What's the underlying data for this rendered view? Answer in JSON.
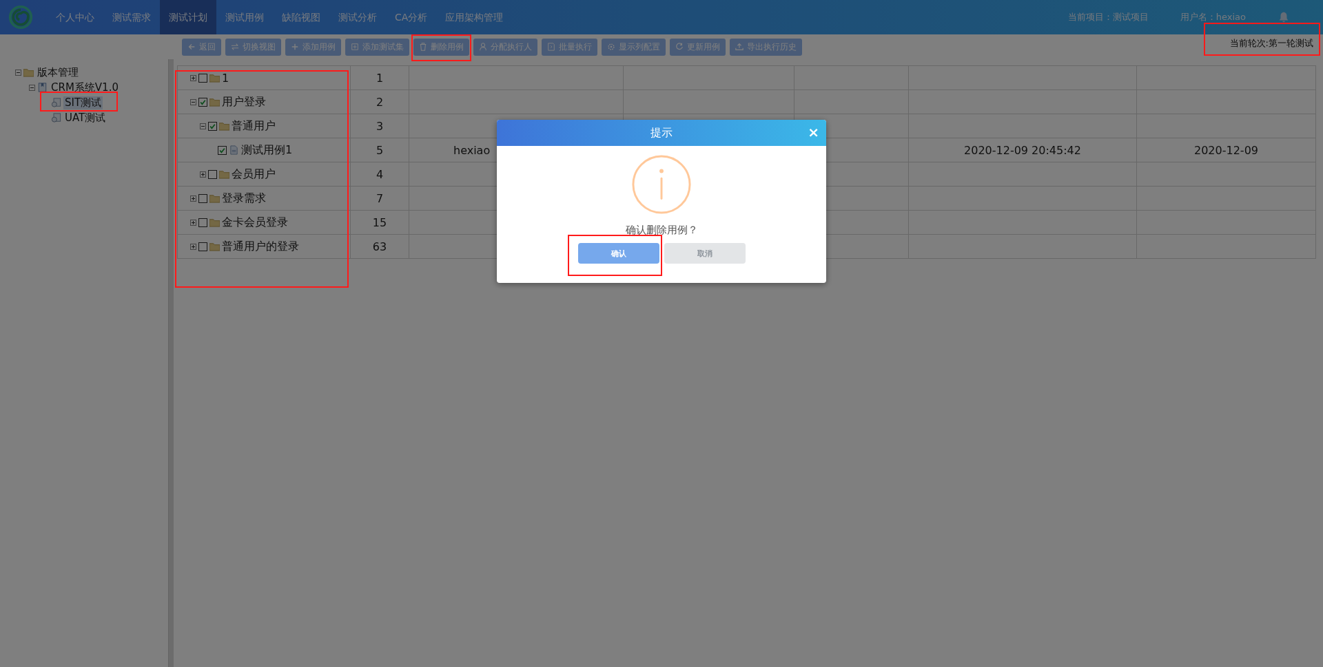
{
  "nav": {
    "items": [
      {
        "label": "个人中心",
        "selected": false
      },
      {
        "label": "测试需求",
        "selected": false
      },
      {
        "label": "测试计划",
        "selected": true
      },
      {
        "label": "测试用例",
        "selected": false
      },
      {
        "label": "缺陷视图",
        "selected": false
      },
      {
        "label": "测试分析",
        "selected": false
      },
      {
        "label": "CA分析",
        "selected": false
      },
      {
        "label": "应用架构管理",
        "selected": false
      }
    ],
    "project": "当前项目：测试项目",
    "user": "用户名：hexiao"
  },
  "toolbar": {
    "buttons": [
      {
        "label": "返回",
        "highlighted": false
      },
      {
        "label": "切换视图",
        "highlighted": false
      },
      {
        "label": "添加用例",
        "highlighted": false
      },
      {
        "label": "添加测试集",
        "highlighted": false
      },
      {
        "label": "删除用例",
        "highlighted": true
      },
      {
        "label": "分配执行人",
        "highlighted": false
      },
      {
        "label": "批量执行",
        "highlighted": false
      },
      {
        "label": "显示列配置",
        "highlighted": false
      },
      {
        "label": "更新用例",
        "highlighted": false
      },
      {
        "label": "导出执行历史",
        "highlighted": false
      }
    ],
    "round": {
      "label": "当前轮次:第一轮测试",
      "highlighted": true
    }
  },
  "sidebar": {
    "items": [
      {
        "label": "版本管理",
        "kind": "folder",
        "expanded": true,
        "selected": false,
        "highlighted": false,
        "children": [
          {
            "label": "CRM系统V1.0",
            "kind": "version",
            "expanded": true,
            "selected": false,
            "highlighted": false,
            "children": [
              {
                "label": "SIT测试",
                "kind": "plan",
                "selected": true,
                "highlighted": true
              },
              {
                "label": "UAT测试",
                "kind": "plan",
                "selected": false,
                "highlighted": false
              }
            ]
          }
        ]
      }
    ]
  },
  "table": {
    "tree_column_highlighted": true,
    "rows": [
      {
        "label": "1",
        "kind": "folder",
        "expanded": false,
        "checked": false,
        "count": "1"
      },
      {
        "label": "用户登录",
        "kind": "folder",
        "expanded": true,
        "checked": true,
        "count": "2",
        "children": [
          {
            "label": "普通用户",
            "kind": "folder",
            "expanded": true,
            "checked": true,
            "count": "3",
            "children": [
              {
                "label": "测试用例1",
                "kind": "case",
                "checked": true,
                "count": "5",
                "column_3": "hexiao",
                "column_6": "2020-12-09 20:45:42",
                "column_7": "2020-12-09"
              }
            ]
          },
          {
            "label": "会员用户",
            "kind": "folder",
            "expanded": false,
            "checked": false,
            "count": "4"
          }
        ]
      },
      {
        "label": "登录需求",
        "kind": "folder",
        "expanded": false,
        "checked": false,
        "count": "7"
      },
      {
        "label": "金卡会员登录",
        "kind": "folder",
        "expanded": false,
        "checked": false,
        "count": "15"
      },
      {
        "label": "普通用户的登录",
        "kind": "folder",
        "expanded": false,
        "checked": false,
        "count": "63"
      }
    ]
  },
  "dialog": {
    "title": "提示",
    "close": "×",
    "message": "确认删除用例？",
    "buttons": [
      {
        "label": "确认",
        "kind": "primary",
        "highlighted": true
      },
      {
        "label": "取消",
        "kind": "secondary",
        "highlighted": false
      }
    ]
  }
}
